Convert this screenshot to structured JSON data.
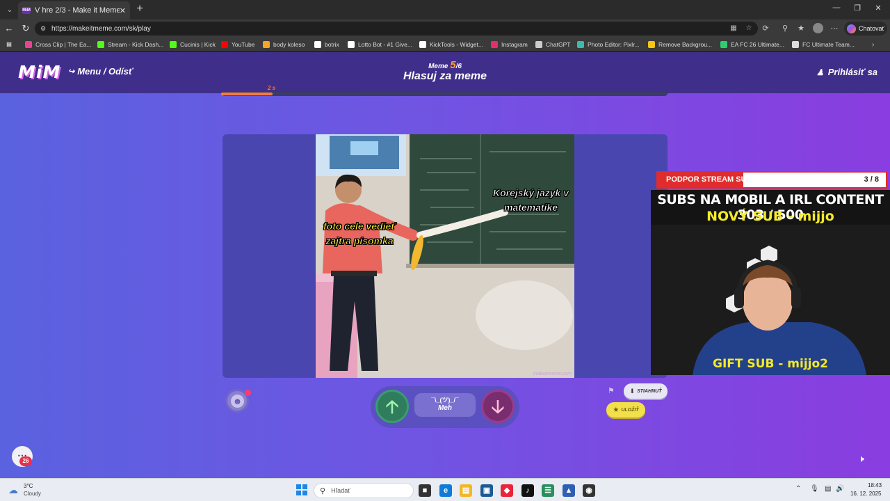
{
  "browser": {
    "tab_title": "V hre 2/3 - Make it Meme",
    "tab_favicon": "MiM",
    "url": "https://makeitmeme.com/sk/play",
    "copilot_label": "Chatovať"
  },
  "bookmarks": [
    {
      "label": "Cross Clip | The Ea...",
      "icon": "crossclip-icon",
      "color": "#e84393"
    },
    {
      "label": "Stream - Kick Dash...",
      "icon": "kick-icon",
      "color": "#53fc18"
    },
    {
      "label": "Cucinis | Kick",
      "icon": "kick-icon",
      "color": "#53fc18"
    },
    {
      "label": "YouTube",
      "icon": "youtube-icon",
      "color": "#ff0000"
    },
    {
      "label": "body koleso",
      "icon": "wheel-icon",
      "color": "#f5a623"
    },
    {
      "label": "botrix",
      "icon": "botrix-icon",
      "color": "#ffffff"
    },
    {
      "label": "Lotto Bot - #1 Give...",
      "icon": "grid-icon",
      "color": "#ffffff"
    },
    {
      "label": "KickTools - Widget...",
      "icon": "grid-icon",
      "color": "#ffffff"
    },
    {
      "label": "Instagram",
      "icon": "instagram-icon",
      "color": "#e1306c"
    },
    {
      "label": "ChatGPT",
      "icon": "chatgpt-icon",
      "color": "#cccccc"
    },
    {
      "label": "Photo Editor: Pixlr...",
      "icon": "pixlr-icon",
      "color": "#3fb8af"
    },
    {
      "label": "Remove Backgrou...",
      "icon": "removebg-icon",
      "color": "#f5c518"
    },
    {
      "label": "EA FC 26 Ultimate...",
      "icon": "ea-icon",
      "color": "#2ecc71"
    },
    {
      "label": "FC Ultimate Team...",
      "icon": "page-icon",
      "color": "#dddddd"
    }
  ],
  "header": {
    "logo": "MiM",
    "menu_label": "Menu / Odísť",
    "meme_label": "Meme",
    "meme_current": "5",
    "meme_total": "/6",
    "heading": "Hlasuj za meme",
    "login_label": "Prihlásiť sa"
  },
  "timer": {
    "label": "2 s",
    "progress": 0.115
  },
  "meme": {
    "caption_left": "foto cele vedieť zajtra písomka",
    "caption_right": "Korejský jazyk v matematike",
    "watermark": "makeitmeme.com"
  },
  "vote": {
    "meh_face": "¯\\_(ツ)_/¯",
    "meh_label": "Meh"
  },
  "actions": {
    "download_label": "STIAHNUŤ",
    "save_label": "ULOŽIŤ"
  },
  "chat": {
    "badge": "26"
  },
  "stream_overlay": {
    "goal_label": "PODPOR STREAM SUBIKOM",
    "goal_count": "3 / 8",
    "goal_progress": 0.375,
    "line1": "SUBS NA MOBIL A IRL CONTENT  303 / 500",
    "line2": "NOVÝ SUB - mijjo",
    "line3": "GIFT SUB - mijjo2"
  },
  "taskbar": {
    "weather_temp": "3°C",
    "weather_cond": "Cloudy",
    "search_placeholder": "Hľadať",
    "time": "18:43",
    "date": "16. 12. 2025"
  }
}
